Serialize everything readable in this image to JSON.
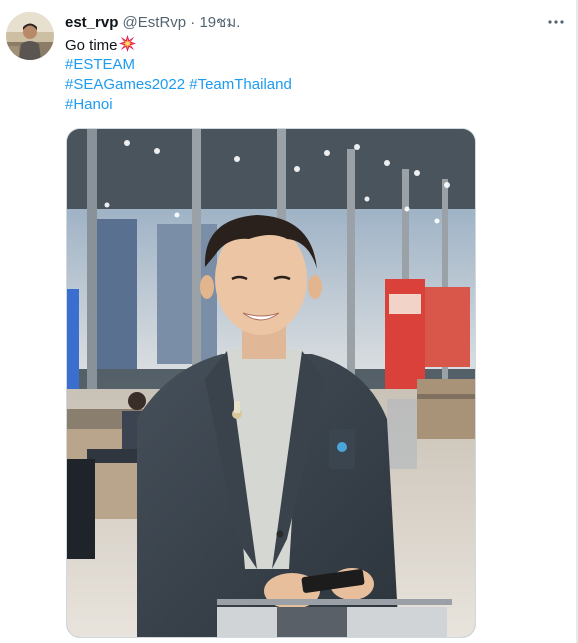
{
  "tweet": {
    "display_name": "est_rvp",
    "handle": "@EstRvp",
    "separator": "·",
    "time": "19ชม.",
    "lines": {
      "first": "Go time",
      "tag1": "#ESTEAM",
      "tag2": "#SEAGames2022",
      "tag3": "#TeamThailand",
      "tag4": "#Hanoi"
    },
    "emoji": "collision-emoji",
    "more_icon": "more-horizontal-icon"
  },
  "colors": {
    "hashtag": "#1d9bf0",
    "text": "#0f1419",
    "secondary": "#536471"
  },
  "media": {
    "type": "photo",
    "subject": "man-in-blazer-at-airport"
  }
}
